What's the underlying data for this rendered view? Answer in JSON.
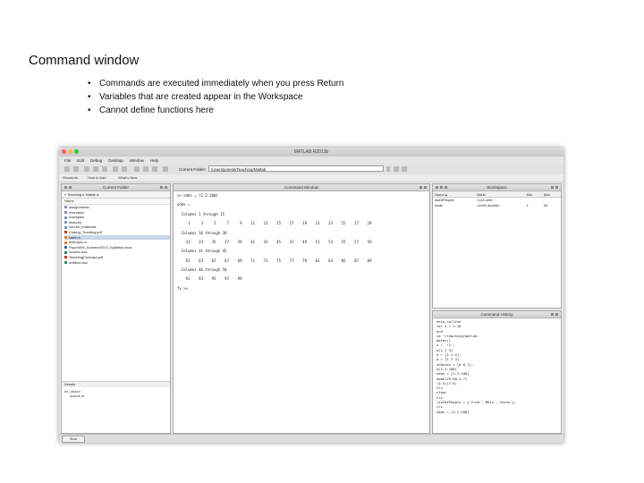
{
  "slide": {
    "title": "Command window",
    "bullets": [
      "Commands are executed immediately when you press Return",
      "Variables that are created appear in the Workspace",
      "Cannot define functions here"
    ]
  },
  "window": {
    "title": "MATLAB R2013b",
    "menu": [
      "File",
      "Edit",
      "Debug",
      "Desktop",
      "Window",
      "Help"
    ],
    "current_folder_label": "Current Folder:",
    "current_folder_path": "/Users/jonesk/Teaching/Matlab",
    "shortcuts": [
      "Shortcuts",
      "How to Add",
      "What's New"
    ],
    "colors": {
      "accent_selection": "#c8d6ea",
      "light_red": "#fc5f57",
      "light_yellow": "#fdbc2e",
      "light_green": "#28c840"
    }
  },
  "current_folder": {
    "title": "Current Folder",
    "path": "« Teaching ▸ Matlab ▸",
    "column_header": "Name",
    "items": [
      "assignments",
      "exercises",
      "examples",
      "lectures",
      "course_materials",
      "Coding_Tracking.pdf",
      "stats.m",
      "testInput.m",
      "Psych599_Summer2013_Syllabus.docx",
      "Scores.xlsx",
      "TeachingContract.pdf",
      "untitled.xlsx"
    ],
    "selected_index": 6,
    "details_header": "Details",
    "details_lines": [
      "ex_nhood",
      "scores.m"
    ]
  },
  "command_window": {
    "title": "Command Window",
    "lines": [
      ">> odds = [1:2:100]",
      "",
      "odds =",
      "",
      "  Columns 1 through 15",
      "",
      "row:1 3 5 7 9 11 13 15 17 19 21 23 25 27 29",
      "",
      "  Columns 16 through 30",
      "",
      "row:31 33 35 37 39 41 43 45 47 49 51 53 55 57 59",
      "",
      "  Columns 31 through 45",
      "",
      "row:61 63 65 67 69 71 73 75 77 79 81 83 85 87 89",
      "",
      "  Columns 46 through 50",
      "",
      "row:91 93 95 97 99",
      "",
      "fx >>"
    ]
  },
  "workspace": {
    "title": "Workspace",
    "header_labels": [
      "Name ▴",
      "Value",
      "Min",
      "Max"
    ],
    "rows": [
      {
        "name": "listOfPeople",
        "value": "<1x3 cell>",
        "min": "",
        "max": ""
      },
      {
        "name": "odds",
        "value": "<1x50 double>",
        "min": "1",
        "max": "99"
      }
    ]
  },
  "command_history": {
    "title": "Command History",
    "lines": [
      "help cellfun",
      "for i = 1:10",
      "end",
      "cd ~/teaching/matlab",
      "dates()",
      "x = '!1';",
      "a(1 2 3]",
      "a = [1:1:5];",
      "a = [1 2 3]",
      "indices = [0 0 7];",
      "a(1:1:100)",
      "odds = [1:2:100]",
      "odds(25:50,1:7)",
      "(1:5)(1:5)",
      "clc",
      "clear",
      "clc",
      "listOfPeople = {'Fred','Mary','Steve'};",
      "clc",
      "odds = [1:2:100]"
    ]
  },
  "status": {
    "start_label": "Start"
  }
}
